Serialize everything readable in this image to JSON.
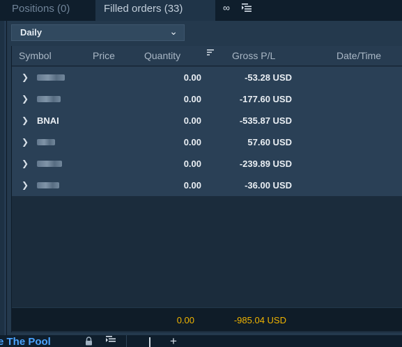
{
  "tabs": [
    {
      "label": "Positions (0)",
      "active": false
    },
    {
      "label": "Filled orders (33)",
      "active": true
    }
  ],
  "icons": {
    "link": "link-icon",
    "columns": "columns-icon",
    "chevron": "chevron-down-icon",
    "sort": "sort-icon",
    "lock": "lock-icon",
    "plus": "plus-icon"
  },
  "filter": {
    "value": "Daily"
  },
  "table": {
    "columns": {
      "symbol": "Symbol",
      "price": "Price",
      "quantity": "Quantity",
      "gross": "Gross P/L",
      "datetime": "Date/Time"
    },
    "rows": [
      {
        "symbol": "",
        "quantity": "0.00",
        "gross": "-53.28 USD"
      },
      {
        "symbol": "",
        "quantity": "0.00",
        "gross": "-177.60 USD"
      },
      {
        "symbol": "BNAI",
        "quantity": "0.00",
        "gross": "-535.87 USD"
      },
      {
        "symbol": "",
        "quantity": "0.00",
        "gross": "57.60 USD"
      },
      {
        "symbol": "",
        "quantity": "0.00",
        "gross": "-239.89 USD"
      },
      {
        "symbol": "",
        "quantity": "0.00",
        "gross": "-36.00 USD"
      }
    ],
    "totals": {
      "quantity": "0.00",
      "gross": "-985.04 USD"
    }
  },
  "bottom": {
    "label": "e The Pool"
  },
  "colors": {
    "accent": "#4aa3ff",
    "totals": "#f0b400",
    "panel": "#24394d"
  }
}
